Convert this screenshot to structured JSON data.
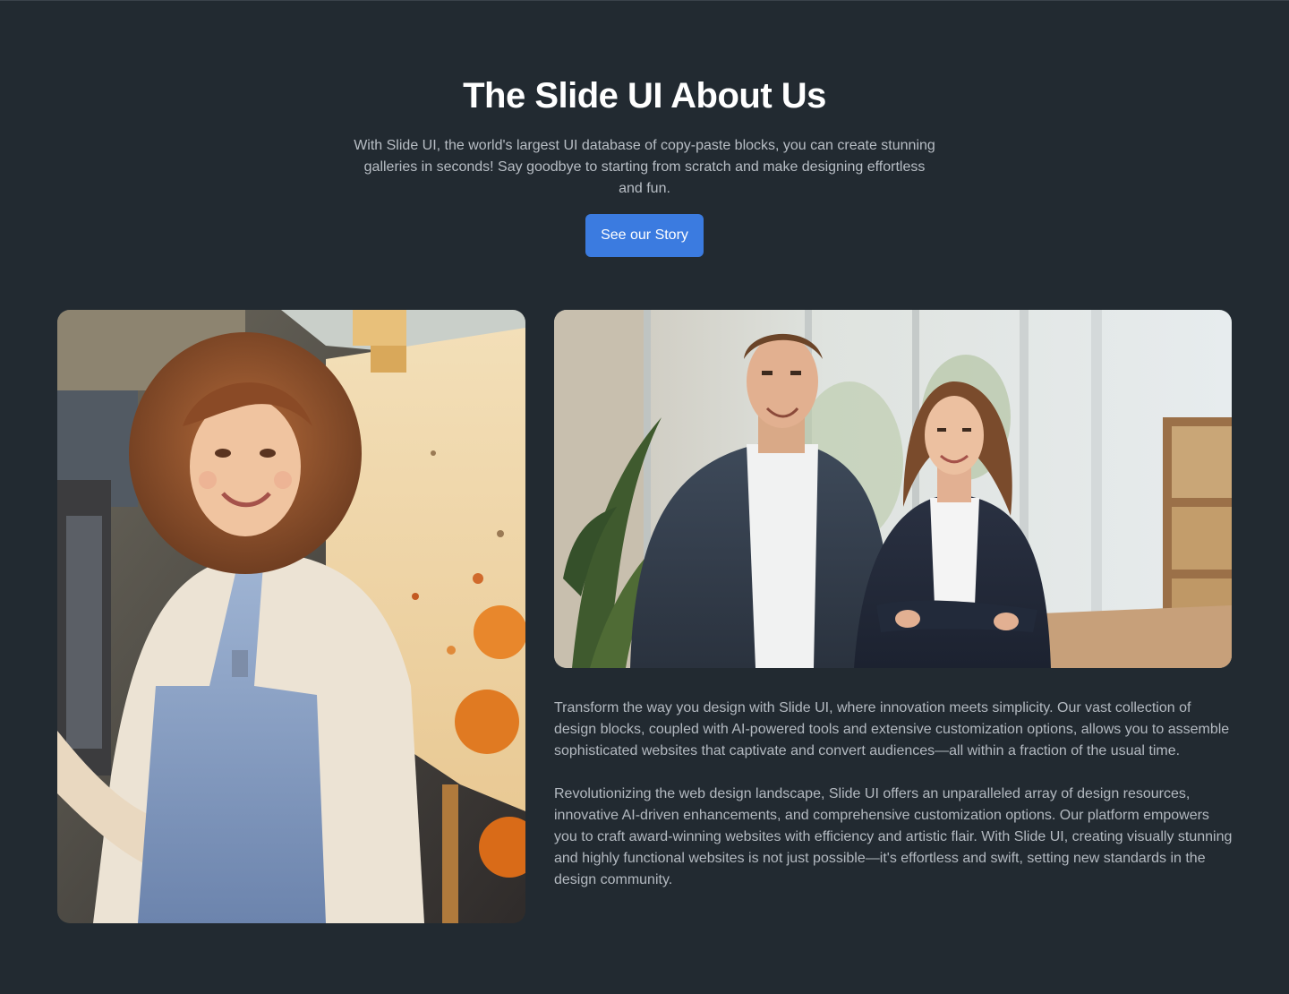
{
  "hero": {
    "title": "The Slide UI About Us",
    "subtitle": "With Slide UI, the world's largest UI database of copy-paste blocks, you can create stunning galleries in seconds! Say goodbye to starting from scratch and make designing effortless and fun.",
    "cta_label": "See our Story"
  },
  "gallery": {
    "left_image": "artist-portrait-image",
    "right_image": "team-portrait-image"
  },
  "about": {
    "paragraph_1": "Transform the way you design with Slide UI, where innovation meets simplicity. Our vast collection of design blocks, coupled with AI-powered tools and extensive customization options, allows you to assemble sophisticated websites that captivate and convert audiences—all within a fraction of the usual time.",
    "paragraph_2": "Revolutionizing the web design landscape, Slide UI offers an unparalleled array of design resources, innovative AI-driven enhancements, and comprehensive customization options. Our platform empowers you to craft award-winning websites with efficiency and artistic flair. With Slide UI, creating visually stunning and highly functional websites is not just possible—it's effortless and swift, setting new standards in the design community."
  },
  "colors": {
    "background": "#222a31",
    "accent": "#3b7be0",
    "heading": "#ffffff",
    "body_text": "#b3b9c0"
  }
}
